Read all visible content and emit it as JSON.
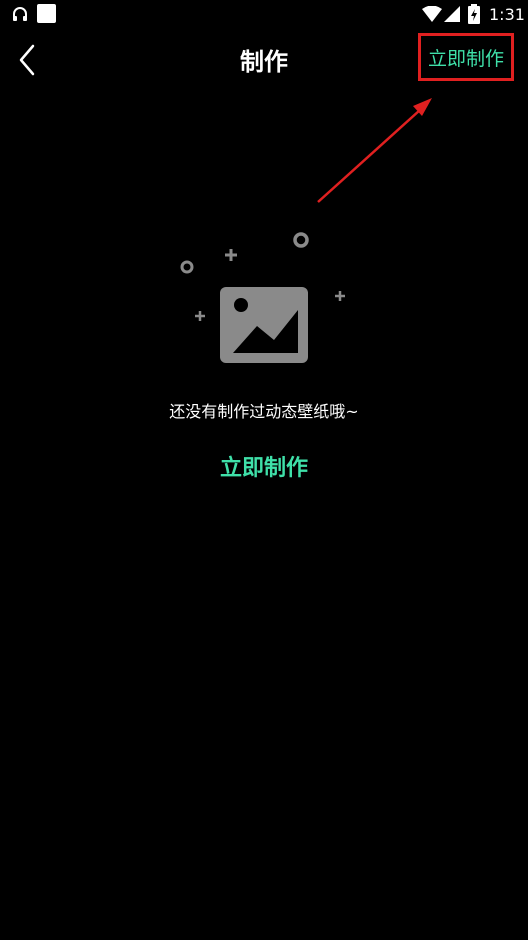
{
  "status_bar": {
    "time": "1:31",
    "icons": [
      "headphones-icon",
      "notification-square-icon",
      "wifi-icon",
      "signal-icon",
      "battery-charging-icon"
    ]
  },
  "header": {
    "title": "制作",
    "back_icon": "chevron-left-icon",
    "action_label": "立即制作"
  },
  "empty_state": {
    "illustration_icon": "image-placeholder-icon",
    "message": "还没有制作过动态壁纸哦~",
    "action_label": "立即制作"
  },
  "colors": {
    "background": "#000000",
    "accent": "#3fe0a9",
    "highlight_border": "#e02020",
    "placeholder_gray": "#8a8a8a"
  }
}
